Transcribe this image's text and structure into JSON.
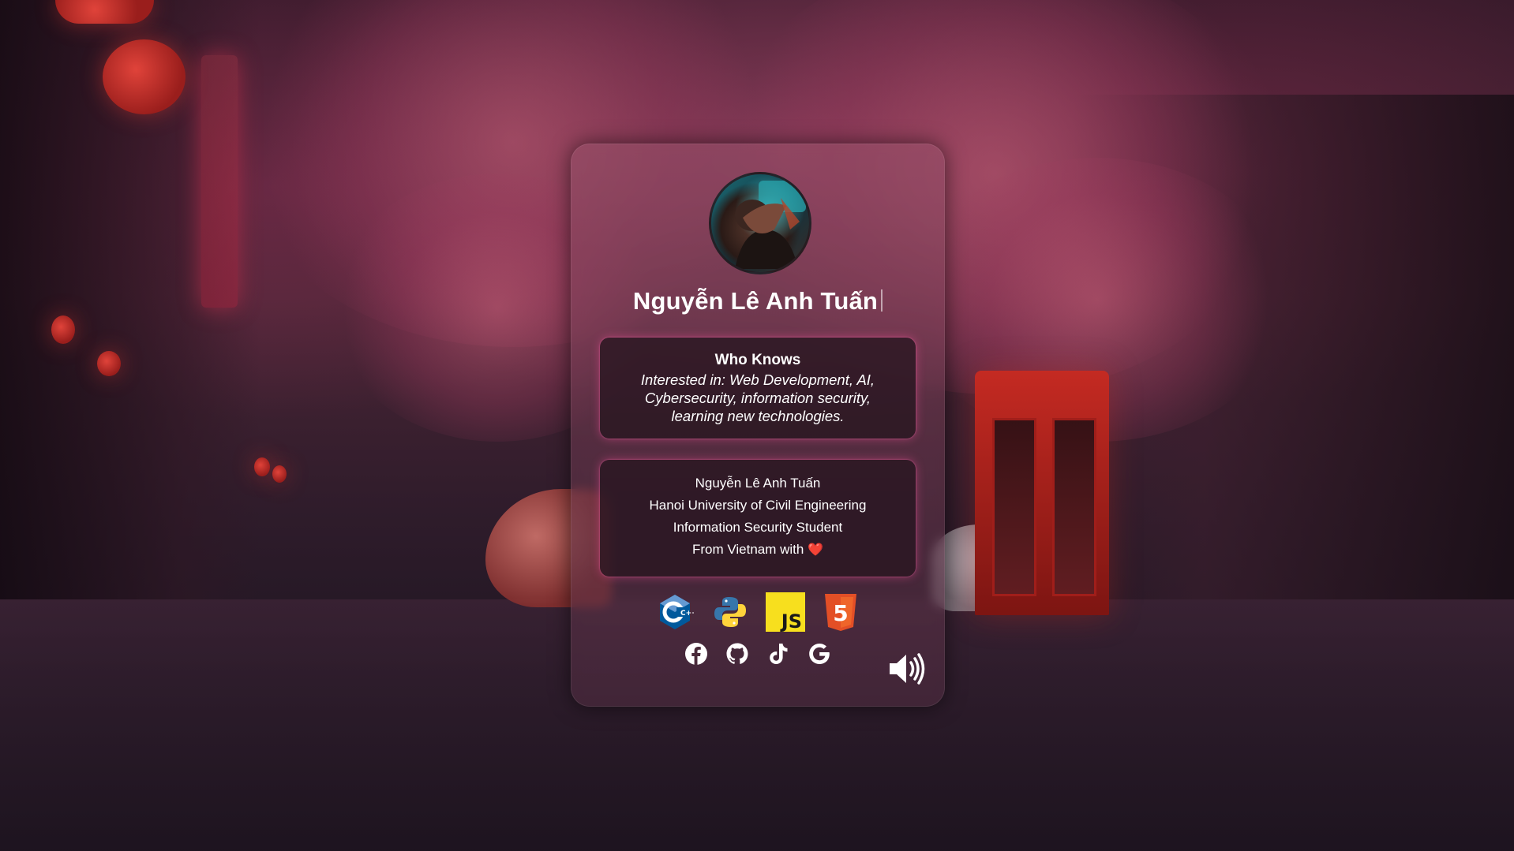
{
  "profile": {
    "name": "Nguyễn Lê Anh Tuấn",
    "avatar_icon": "avatar-photo"
  },
  "about": {
    "title": "Who Knows",
    "description": "Interested in: Web Development, AI, Cybersecurity, information security, learning new technologies."
  },
  "info": {
    "lines": [
      "Nguyễn Lê Anh Tuấn",
      "Hanoi University of Civil Engineering",
      "Information Security Student",
      "From Vietnam with"
    ],
    "heart_glyph": "❤️"
  },
  "tech_icons": [
    {
      "name": "cpp-icon",
      "label": "C++"
    },
    {
      "name": "python-icon",
      "label": "Python"
    },
    {
      "name": "javascript-icon",
      "label": "JS"
    },
    {
      "name": "html5-icon",
      "label": "5"
    }
  ],
  "social_icons": [
    "facebook-icon",
    "github-icon",
    "tiktok-icon",
    "google-icon"
  ],
  "controls": {
    "sound_icon": "volume-icon"
  },
  "colors": {
    "accent_glow": "#ff50a0",
    "heart": "#ff4d7e",
    "card_bg": "#8a4a64",
    "box_bg": "#28161f"
  }
}
